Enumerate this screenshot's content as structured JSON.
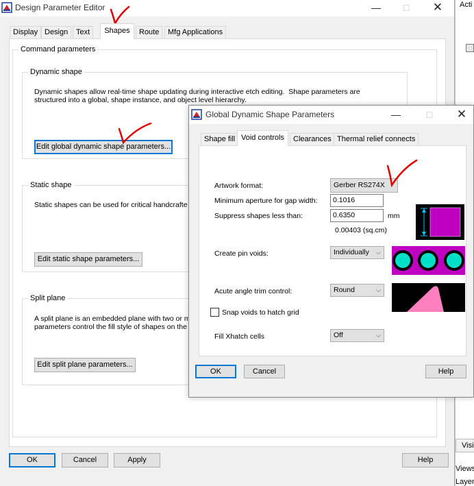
{
  "main_window": {
    "title": "Design Parameter Editor",
    "tabs": [
      "Display",
      "Design",
      "Text",
      "Shapes",
      "Route",
      "Mfg Applications"
    ],
    "active_tab": "Shapes",
    "command_parameters_label": "Command parameters",
    "dynamic_shape": {
      "label": "Dynamic shape",
      "description": "Dynamic shapes allow real-time shape updating during interactive etch editing.  Shape parameters are\nstructured into a global, shape instance, and object level hierarchy.",
      "button": "Edit global dynamic shape parameters..."
    },
    "static_shape": {
      "label": "Static shape",
      "description": "Static shapes can be used for critical handcrafte",
      "button": "Edit static shape parameters..."
    },
    "split_plane": {
      "label": "Split plane",
      "description": "A split plane is an embedded plane with two or m\nparameters control the fill style of shapes on the",
      "button": "Edit split plane parameters..."
    },
    "buttons": {
      "ok": "OK",
      "cancel": "Cancel",
      "apply": "Apply",
      "help": "Help"
    }
  },
  "background_window": {
    "text_acti": "Acti",
    "text_visib": "Visib",
    "text_views": "Views",
    "text_layer": "Layer"
  },
  "dialog": {
    "title": "Global Dynamic Shape Parameters",
    "tabs": [
      "Shape fill",
      "Void controls",
      "Clearances",
      "Thermal relief connects"
    ],
    "active_tab": "Void controls",
    "artwork_format_label": "Artwork format:",
    "artwork_format_value": "Gerber RS274X",
    "min_aperture_label": "Minimum aperture for gap width:",
    "min_aperture_value": "0.1016",
    "suppress_label": "Suppress shapes less than:",
    "suppress_value": "0.6350",
    "suppress_unit": "mm",
    "suppress_area": "0.00403 (sq.cm)",
    "pin_voids_label": "Create pin voids:",
    "pin_voids_value": "Individually",
    "acute_angle_label": "Acute angle trim control:",
    "acute_angle_value": "Round",
    "snap_voids_label": "Snap voids to hatch grid",
    "fill_xhatch_label": "Fill Xhatch cells",
    "fill_xhatch_value": "Off",
    "buttons": {
      "ok": "OK",
      "cancel": "Cancel",
      "help": "Help"
    }
  },
  "colors": {
    "magenta": "#c000c0",
    "cyan": "#00e0c8",
    "pink": "#ff80c0",
    "annotation_red": "#e00000"
  }
}
